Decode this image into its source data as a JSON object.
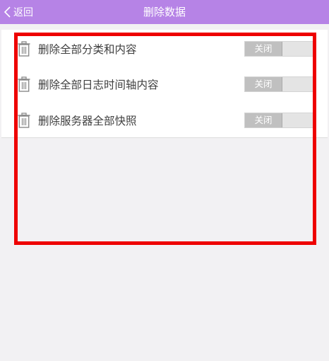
{
  "header": {
    "back_label": "返回",
    "title": "删除数据"
  },
  "rows": [
    {
      "label": "删除全部分类和内容",
      "toggle_label": "关闭"
    },
    {
      "label": "删除全部日志时间轴内容",
      "toggle_label": "关闭"
    },
    {
      "label": "删除服务器全部快照",
      "toggle_label": "关闭"
    }
  ],
  "colors": {
    "nav_bar": "#b683e6",
    "highlight": "#ee0000",
    "toggle_off": "#c0c0c0"
  }
}
